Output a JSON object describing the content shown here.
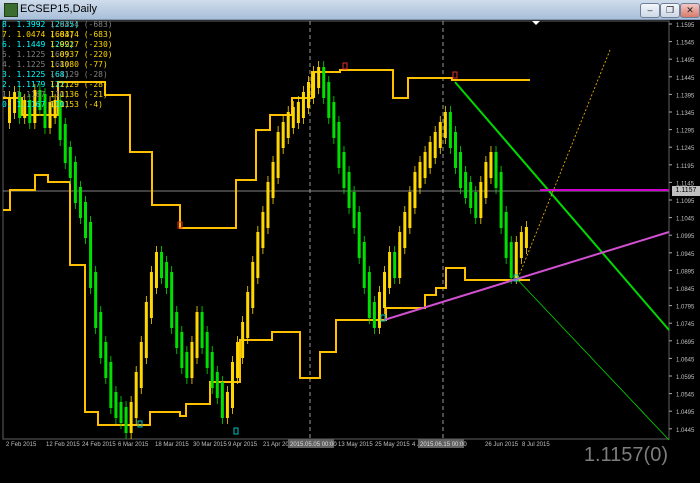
{
  "window": {
    "title": "ECSEP15,Daily",
    "controls": [
      "minimize",
      "restore",
      "close"
    ]
  },
  "chart": {
    "symbol": "ECSEP15",
    "timeframe": "Daily",
    "current_price": "1.1157",
    "current_price_big": "1.1157(0)",
    "price_axis": [
      "1.1595",
      "1.1545",
      "1.1495",
      "1.1445",
      "1.1395",
      "1.1345",
      "1.1295",
      "1.1245",
      "1.1195",
      "1.1145",
      "1.1095",
      "1.1045",
      "1.0995",
      "1.0945",
      "1.0895",
      "1.0845",
      "1.0795",
      "1.0745",
      "1.0695",
      "1.0645",
      "1.0595",
      "1.0545",
      "1.0495",
      "1.0445"
    ],
    "time_axis": [
      "2 Feb 2015",
      "12 Feb 2015",
      "24 Feb 2015",
      "6 Mar 2015",
      "18 Mar 2015",
      "30 Mar 2015",
      "9 Apr 2015",
      "21 Apr 2015",
      "2015.05.05 00:00",
      "13 May 2015",
      "25 May 2015",
      "4 Jun",
      "2015.06.15 00:00",
      "26 Jun 2015",
      "8 Jul 2015"
    ],
    "legend": [
      {
        "a": "8. 1.3992 (2835)",
        "b": "1.0474 (-683)",
        "ca": "#00ffff",
        "cb": "#808080"
      },
      {
        "a": "7. 1.0474 (683)",
        "b": "1.0474 (-683)",
        "ca": "#ffd700",
        "cb": "#ffd700"
      },
      {
        "a": "6. 1.1449 (292)",
        "b": "1.0927 (-230)",
        "ca": "#00ffff",
        "cb": "#ffd700"
      },
      {
        "a": "5. 1.1225 (68)",
        "b": "1.0937 (-220)",
        "ca": "#808080",
        "cb": "#ffd700"
      },
      {
        "a": "4. 1.1225 (68)",
        "b": "1.1080 (-77)",
        "ca": "#808080",
        "cb": "#ffd700"
      },
      {
        "a": "3. 1.1225 (68)",
        "b": "1.1129 (-28)",
        "ca": "#00ffff",
        "cb": "#808080"
      },
      {
        "a": "2. 1.1179 (22)",
        "b": "1.1129 (-28)",
        "ca": "#00ffff",
        "cb": "#ffd700"
      },
      {
        "a": "1. 1.1167 (10)",
        "b": "1.1136 (-21)",
        "ca": "#808080",
        "cb": "#ffd700"
      },
      {
        "a": "0. 1.1167 (10)",
        "b": "1.1153 (-4)",
        "ca": "#00ffff",
        "cb": "#ffd700"
      }
    ],
    "colors": {
      "up": "#ffd700",
      "down": "#00e000",
      "band": "#ffc000",
      "trend_green": "#00d800",
      "trend_magenta": "#d050d0",
      "bg": "#000000"
    },
    "ylim": [
      1.0445,
      1.1595
    ]
  }
}
